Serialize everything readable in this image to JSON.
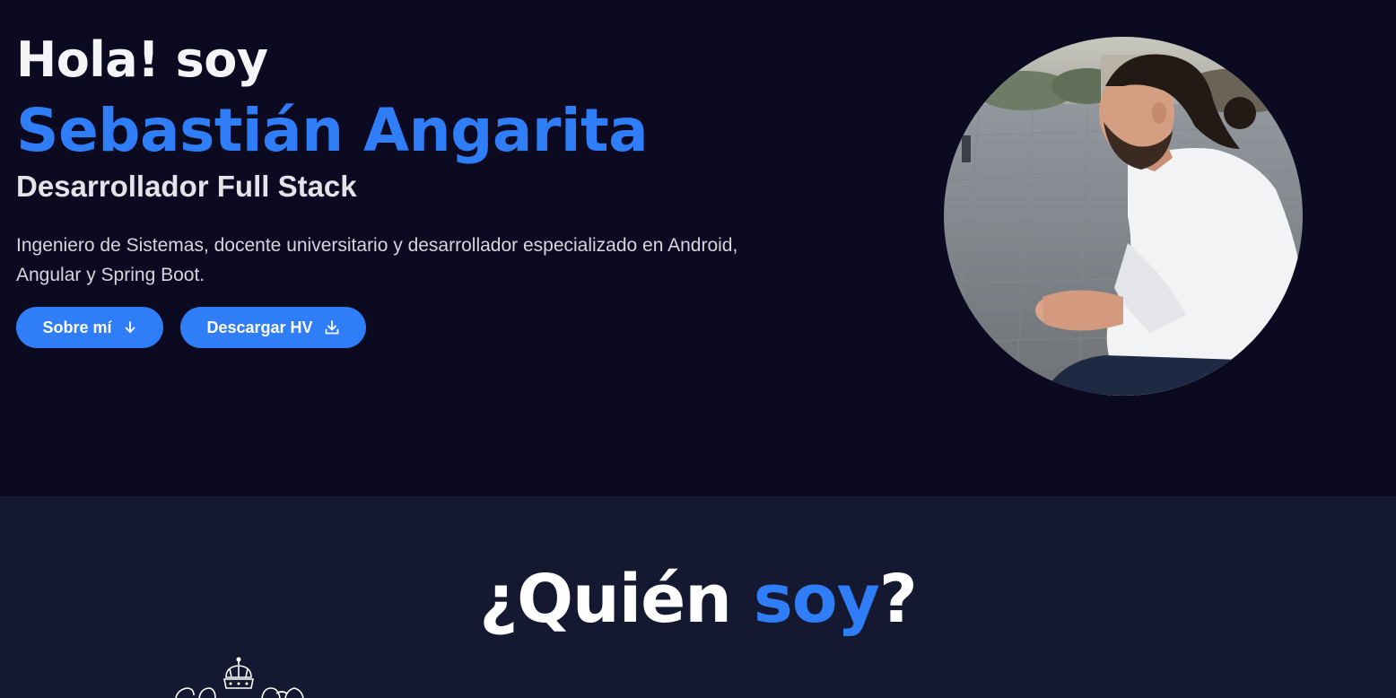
{
  "hero": {
    "greeting": "Hola! soy",
    "name": "Sebastián Angarita",
    "role": "Desarrollador Full Stack",
    "bio": "Ingeniero de Sistemas, docente universitario y desarrollador especializado en Android, Angular y Spring Boot.",
    "buttons": {
      "about_label": "Sobre mí",
      "about_icon": "arrow-down-icon",
      "cv_label": "Descargar HV",
      "cv_icon": "download-icon"
    },
    "photo": "profile-photo"
  },
  "about": {
    "title_prefix": "¿Quién ",
    "title_accent": "soy",
    "title_suffix": "?",
    "crest": "university-crest-logo"
  },
  "colors": {
    "hero_bg": "#0c0a21",
    "section_bg": "#141830",
    "accent": "#2f7df7",
    "text": "#ffffff"
  }
}
